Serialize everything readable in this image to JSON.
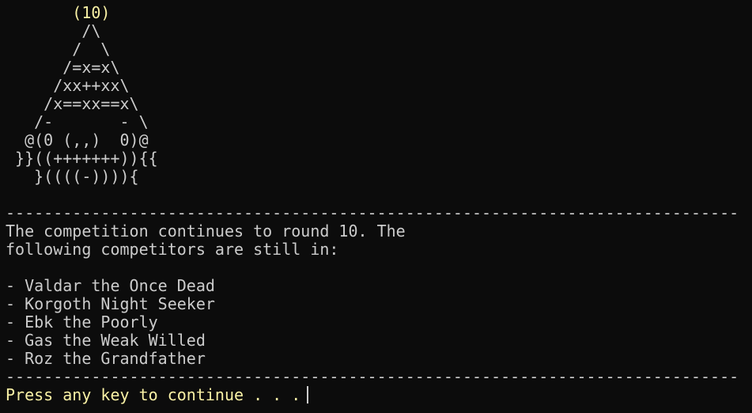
{
  "colors": {
    "background": "#0c0c0c",
    "foreground": "#cccccc",
    "prompt_yellow": "#f9f1a5"
  },
  "terminal": {
    "art_lines": [
      "       (10)",
      "        /\\",
      "       /  \\",
      "      /=x=x\\",
      "     /xx++xx\\",
      "    /x==xx==x\\",
      "   /-       - \\",
      "  @(0 (,,)  0)@",
      " }}((+++++++)){{",
      "   }((((-)))){"
    ],
    "separator": "-----------------------------------------------------------------------------",
    "message_lines": [
      "The competition continues to round 10. The",
      "following competitors are still in:"
    ],
    "competitors": [
      "- Valdar the Once Dead",
      "- Korgoth Night Seeker",
      "- Ebk the Poorly",
      "- Gas the Weak Willed",
      "- Roz the Grandfather"
    ],
    "prompt": "Press any key to continue . . ."
  }
}
